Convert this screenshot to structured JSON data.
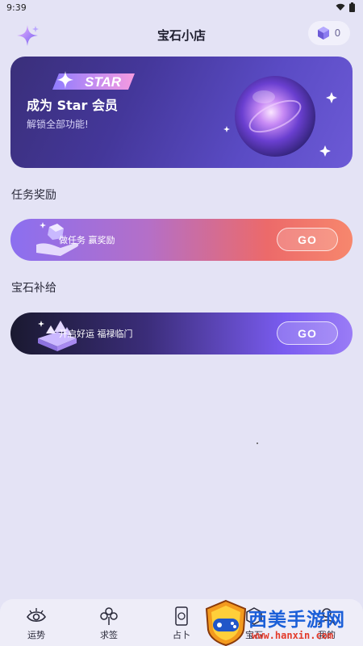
{
  "status_bar": {
    "time": "9:39"
  },
  "header": {
    "title": "宝石小店",
    "gem_count": "0"
  },
  "star_banner": {
    "badge": "STAR",
    "title": "成为 Star 会员",
    "subtitle": "解锁全部功能!"
  },
  "sections": {
    "tasks_title": "任务奖励",
    "supply_title": "宝石补给"
  },
  "task_card": {
    "text": "做任务 赢奖励",
    "button": "GO"
  },
  "supply_card": {
    "text": "开启好运 福禄临门",
    "button": "GO"
  },
  "bottom_nav": {
    "items": [
      {
        "label": "运势",
        "icon": "eye-icon"
      },
      {
        "label": "求签",
        "icon": "clover-icon"
      },
      {
        "label": "占卜",
        "icon": "tarot-card-icon"
      },
      {
        "label": "宝石",
        "icon": "gem-icon"
      },
      {
        "label": "我的",
        "icon": "profile-icon"
      }
    ]
  },
  "watermark": {
    "text": "西美手游网",
    "url": "www.hanxin.com"
  }
}
